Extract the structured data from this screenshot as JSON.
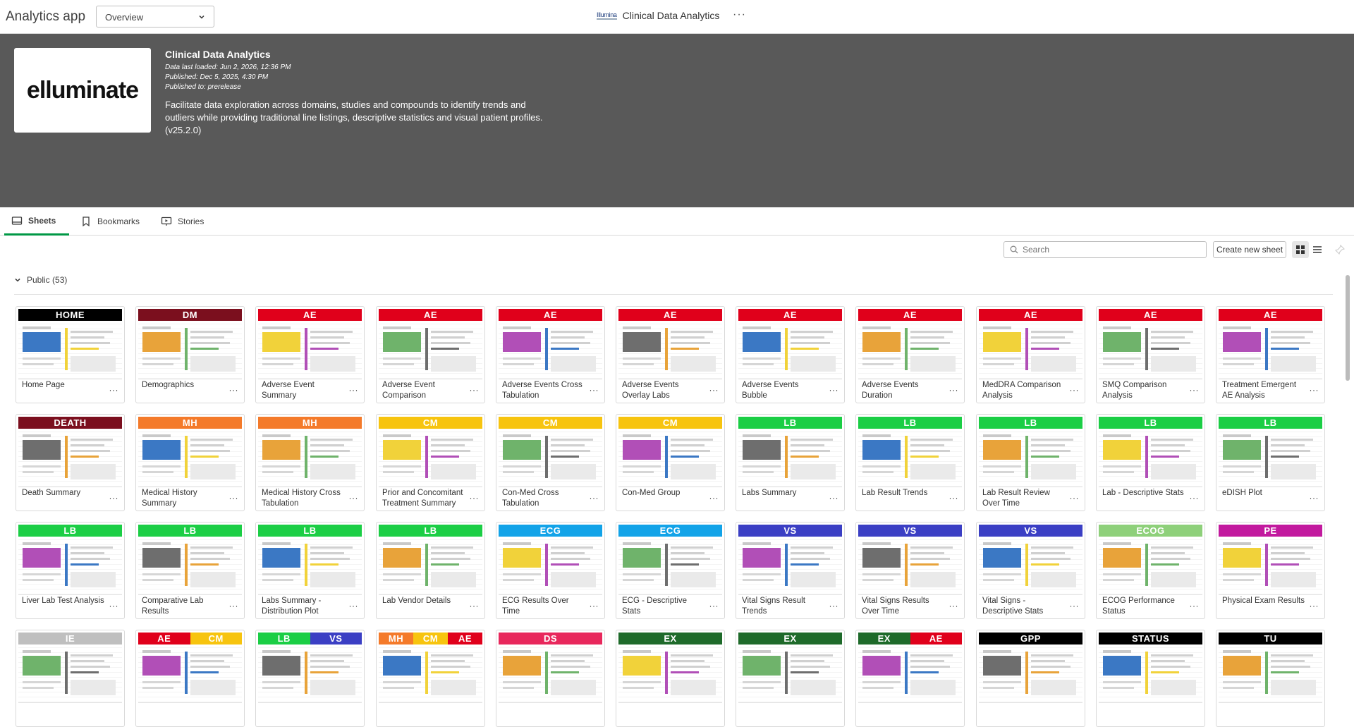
{
  "topbar": {
    "app_title": "Analytics app",
    "sheet_selector": "Overview",
    "brand_logo": "Illumina",
    "brand_name": "Clinical Data Analytics"
  },
  "hero": {
    "thumbnail_text": "elluminate",
    "title": "Clinical Data Analytics",
    "meta": [
      "Data last loaded: Jun 2, 2026, 12:36 PM",
      "Published: Dec 5, 2025, 4:30 PM",
      "Published to: prerelease"
    ],
    "description": "Facilitate data exploration across domains, studies and compounds to identify trends and outliers while providing traditional line listings, descriptive statistics and visual patient profiles. (v25.2.0)"
  },
  "tabs": [
    {
      "label": "Sheets",
      "icon": "sheet-icon"
    },
    {
      "label": "Bookmarks",
      "icon": "bookmark-icon"
    },
    {
      "label": "Stories",
      "icon": "story-icon"
    }
  ],
  "toolbar": {
    "search_placeholder": "Search",
    "create_label": "Create new sheet"
  },
  "section": {
    "label": "Public (53)"
  },
  "colors": {
    "HOME": "#000000",
    "DM": "#7b0f1e",
    "AE": "#e0001b",
    "DEATH": "#7b0f1e",
    "MH": "#f47a2a",
    "CM": "#f7c40f",
    "LB": "#1bce45",
    "ECG": "#12a3e8",
    "VS": "#3b3fc4",
    "ECOG": "#8ed07a",
    "PE": "#c2199e",
    "IE": "#bfbfbf",
    "DS": "#e8285c",
    "EX": "#1e6a2a",
    "GPP": "#000000",
    "STATUS": "#000000",
    "TU": "#000000"
  },
  "sheets": [
    {
      "tags": [
        "HOME"
      ],
      "title": "Home Page"
    },
    {
      "tags": [
        "DM"
      ],
      "title": "Demographics"
    },
    {
      "tags": [
        "AE"
      ],
      "title": "Adverse Event Summary"
    },
    {
      "tags": [
        "AE"
      ],
      "title": "Adverse Event Comparison"
    },
    {
      "tags": [
        "AE"
      ],
      "title": "Adverse Events Cross Tabulation"
    },
    {
      "tags": [
        "AE"
      ],
      "title": "Adverse Events Overlay Labs"
    },
    {
      "tags": [
        "AE"
      ],
      "title": "Adverse Events Bubble"
    },
    {
      "tags": [
        "AE"
      ],
      "title": "Adverse Events Duration"
    },
    {
      "tags": [
        "AE"
      ],
      "title": "MedDRA Comparison Analysis"
    },
    {
      "tags": [
        "AE"
      ],
      "title": "SMQ Comparison Analysis"
    },
    {
      "tags": [
        "AE"
      ],
      "title": "Treatment Emergent AE Analysis"
    },
    {
      "tags": [
        "DEATH"
      ],
      "title": "Death Summary"
    },
    {
      "tags": [
        "MH"
      ],
      "title": "Medical History Summary"
    },
    {
      "tags": [
        "MH"
      ],
      "title": "Medical History Cross Tabulation"
    },
    {
      "tags": [
        "CM"
      ],
      "title": "Prior and Concomitant Treatment Summary"
    },
    {
      "tags": [
        "CM"
      ],
      "title": "Con-Med Cross Tabulation"
    },
    {
      "tags": [
        "CM"
      ],
      "title": "Con-Med Group"
    },
    {
      "tags": [
        "LB"
      ],
      "title": "Labs Summary"
    },
    {
      "tags": [
        "LB"
      ],
      "title": "Lab Result Trends"
    },
    {
      "tags": [
        "LB"
      ],
      "title": "Lab Result Review Over Time"
    },
    {
      "tags": [
        "LB"
      ],
      "title": "Lab - Descriptive Stats"
    },
    {
      "tags": [
        "LB"
      ],
      "title": "eDISH Plot"
    },
    {
      "tags": [
        "LB"
      ],
      "title": "Liver Lab Test Analysis"
    },
    {
      "tags": [
        "LB"
      ],
      "title": "Comparative Lab Results"
    },
    {
      "tags": [
        "LB"
      ],
      "title": "Labs Summary - Distribution Plot"
    },
    {
      "tags": [
        "LB"
      ],
      "title": "Lab Vendor Details"
    },
    {
      "tags": [
        "ECG"
      ],
      "title": "ECG Results Over Time"
    },
    {
      "tags": [
        "ECG"
      ],
      "title": "ECG - Descriptive Stats"
    },
    {
      "tags": [
        "VS"
      ],
      "title": "Vital Signs Result Trends"
    },
    {
      "tags": [
        "VS"
      ],
      "title": "Vital Signs Results Over Time"
    },
    {
      "tags": [
        "VS"
      ],
      "title": "Vital Signs - Descriptive Stats"
    },
    {
      "tags": [
        "ECOG"
      ],
      "title": "ECOG Performance Status"
    },
    {
      "tags": [
        "PE"
      ],
      "title": "Physical Exam Results"
    },
    {
      "tags": [
        "IE"
      ],
      "title": ""
    },
    {
      "tags": [
        "AE",
        "CM"
      ],
      "title": ""
    },
    {
      "tags": [
        "LB",
        "VS"
      ],
      "title": ""
    },
    {
      "tags": [
        "MH",
        "CM",
        "AE"
      ],
      "title": ""
    },
    {
      "tags": [
        "DS"
      ],
      "title": ""
    },
    {
      "tags": [
        "EX"
      ],
      "title": ""
    },
    {
      "tags": [
        "EX"
      ],
      "title": ""
    },
    {
      "tags": [
        "EX",
        "AE"
      ],
      "title": ""
    },
    {
      "tags": [
        "GPP"
      ],
      "title": ""
    },
    {
      "tags": [
        "STATUS"
      ],
      "title": ""
    },
    {
      "tags": [
        "TU"
      ],
      "title": ""
    }
  ]
}
